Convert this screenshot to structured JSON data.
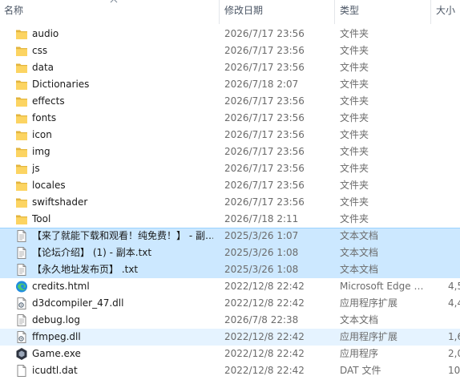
{
  "header": {
    "name": "名称",
    "date": "修改日期",
    "type": "类型",
    "size": "大小"
  },
  "files": [
    {
      "name": "audio",
      "date": "2026/7/17 23:56",
      "type": "文件夹",
      "size": "",
      "icon": "folder-icon",
      "state": ""
    },
    {
      "name": "css",
      "date": "2026/7/17 23:56",
      "type": "文件夹",
      "size": "",
      "icon": "folder-icon",
      "state": ""
    },
    {
      "name": "data",
      "date": "2026/7/17 23:56",
      "type": "文件夹",
      "size": "",
      "icon": "folder-icon",
      "state": ""
    },
    {
      "name": "Dictionaries",
      "date": "2026/7/18 2:07",
      "type": "文件夹",
      "size": "",
      "icon": "folder-icon",
      "state": ""
    },
    {
      "name": "effects",
      "date": "2026/7/17 23:56",
      "type": "文件夹",
      "size": "",
      "icon": "folder-icon",
      "state": ""
    },
    {
      "name": "fonts",
      "date": "2026/7/17 23:56",
      "type": "文件夹",
      "size": "",
      "icon": "folder-icon",
      "state": ""
    },
    {
      "name": "icon",
      "date": "2026/7/17 23:56",
      "type": "文件夹",
      "size": "",
      "icon": "folder-icon",
      "state": ""
    },
    {
      "name": "img",
      "date": "2026/7/17 23:56",
      "type": "文件夹",
      "size": "",
      "icon": "folder-icon",
      "state": ""
    },
    {
      "name": "js",
      "date": "2026/7/17 23:56",
      "type": "文件夹",
      "size": "",
      "icon": "folder-icon",
      "state": ""
    },
    {
      "name": "locales",
      "date": "2026/7/17 23:56",
      "type": "文件夹",
      "size": "",
      "icon": "folder-icon",
      "state": ""
    },
    {
      "name": "swiftshader",
      "date": "2026/7/17 23:56",
      "type": "文件夹",
      "size": "",
      "icon": "folder-icon",
      "state": ""
    },
    {
      "name": "Tool",
      "date": "2026/7/18 2:11",
      "type": "文件夹",
      "size": "",
      "icon": "folder-icon",
      "state": ""
    },
    {
      "name": "【来了就能下载和观看！纯免费！】 - 副…",
      "date": "2025/3/26 1:07",
      "type": "文本文档",
      "size": "",
      "icon": "text-document-icon",
      "state": "selected"
    },
    {
      "name": "【论坛介绍】 (1) - 副本.txt",
      "date": "2025/3/26 1:08",
      "type": "文本文档",
      "size": "",
      "icon": "text-document-icon",
      "state": "selected"
    },
    {
      "name": "【永久地址发布页】 .txt",
      "date": "2025/3/26 1:08",
      "type": "文本文档",
      "size": "",
      "icon": "text-document-icon",
      "state": "selected"
    },
    {
      "name": "credits.html",
      "date": "2022/12/8 22:42",
      "type": "Microsoft Edge …",
      "size": "4,5",
      "icon": "edge-icon",
      "state": ""
    },
    {
      "name": "d3dcompiler_47.dll",
      "date": "2022/12/8 22:42",
      "type": "应用程序扩展",
      "size": "4,4",
      "icon": "dll-icon",
      "state": ""
    },
    {
      "name": "debug.log",
      "date": "2026/7/8 22:38",
      "type": "文本文档",
      "size": "",
      "icon": "text-document-icon",
      "state": ""
    },
    {
      "name": "ffmpeg.dll",
      "date": "2022/12/8 22:42",
      "type": "应用程序扩展",
      "size": "1,6",
      "icon": "dll-icon",
      "state": "hover"
    },
    {
      "name": "Game.exe",
      "date": "2022/12/8 22:42",
      "type": "应用程序",
      "size": "2,0",
      "icon": "game-exe-icon",
      "state": ""
    },
    {
      "name": "icudtl.dat",
      "date": "2022/12/8 22:42",
      "type": "DAT 文件",
      "size": "10,5",
      "icon": "data-file-icon",
      "state": ""
    }
  ]
}
